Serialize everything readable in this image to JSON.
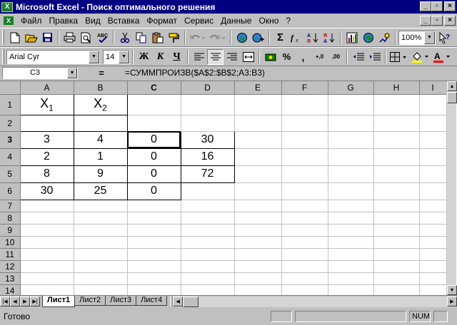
{
  "window": {
    "title": "Microsoft Excel - Поиск оптимального решения",
    "app_icon": "X"
  },
  "window_buttons": [
    "_",
    "▫",
    "×"
  ],
  "menu": [
    "Файл",
    "Правка",
    "Вид",
    "Вставка",
    "Формат",
    "Сервис",
    "Данные",
    "Окно",
    "?"
  ],
  "standard_toolbar": {
    "zoom": "100%",
    "icons": [
      "new-icon",
      "open-icon",
      "save-icon",
      "print-icon",
      "print-preview-icon",
      "spelling-icon",
      "cut-icon",
      "copy-icon",
      "paste-icon",
      "format-painter-icon",
      "undo-icon",
      "redo-icon",
      "web-icon",
      "hyperlink-icon",
      "autosum-icon",
      "function-icon",
      "sort-ascending-icon",
      "sort-descending-icon",
      "chart-wizard-icon",
      "map-icon",
      "drawing-icon"
    ]
  },
  "format_toolbar": {
    "font": "Arial Cyr",
    "size": "14",
    "bold": "Ж",
    "italic": "К",
    "underline": "Ч",
    "currency": "%",
    "comma": ",",
    "inc_decimal": "+,0",
    "dec_decimal": ",00",
    "font_color_letter": "A"
  },
  "formula_bar": {
    "cell_ref": "C3",
    "equals": "=",
    "formula": "=СУММПРОИЗВ($A$2:$B$2;A3:B3)"
  },
  "columns": [
    "A",
    "B",
    "C",
    "D",
    "E",
    "F",
    "G",
    "H",
    "I"
  ],
  "rows": [
    "1",
    "2",
    "3",
    "4",
    "5",
    "6",
    "7",
    "8",
    "9",
    "10",
    "11",
    "12",
    "13",
    "14"
  ],
  "cells": {
    "A1": {
      "text": "X",
      "sub": "1"
    },
    "B1": {
      "text": "X",
      "sub": "2"
    },
    "A3": "3",
    "B3": "4",
    "C3": "0",
    "D3": "30",
    "A4": "2",
    "B4": "1",
    "C4": "0",
    "D4": "16",
    "A5": "8",
    "B5": "9",
    "C5": "0",
    "D5": "72",
    "A6": "30",
    "B6": "25",
    "C6": "0"
  },
  "sheets": [
    "Лист1",
    "Лист2",
    "Лист3",
    "Лист4"
  ],
  "active_sheet": "Лист1",
  "status": {
    "text": "Готово",
    "num": "NUM"
  }
}
